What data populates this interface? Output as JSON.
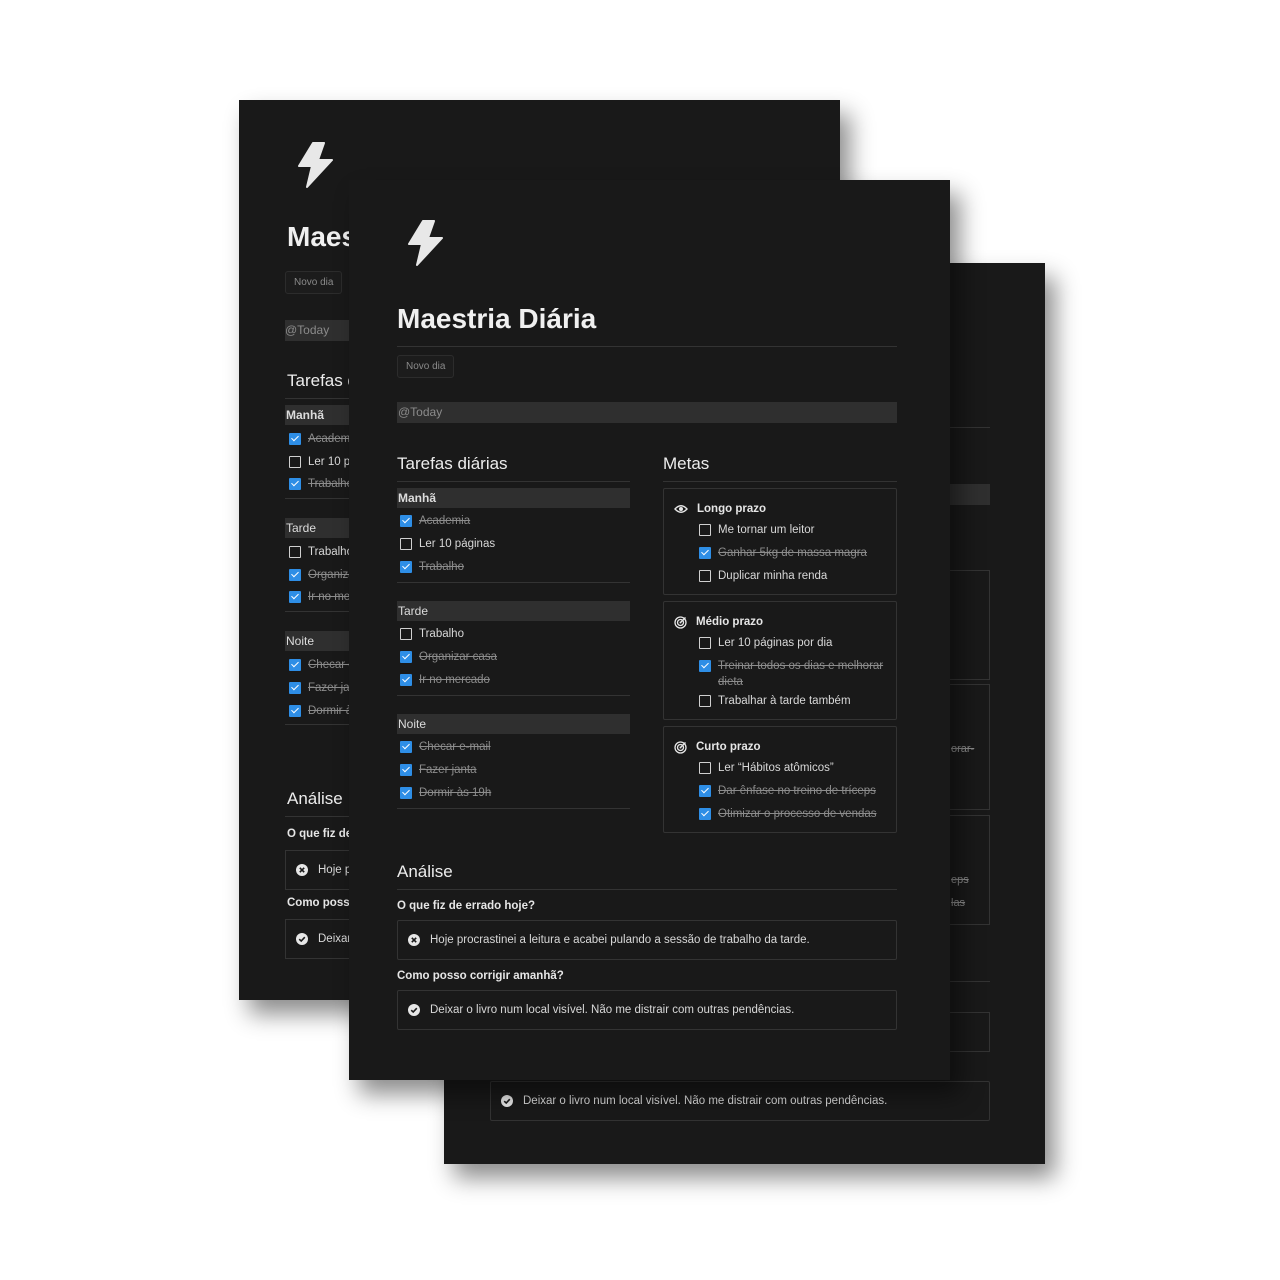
{
  "page": {
    "title": "Maestria Diária",
    "new_day_button": "Novo dia",
    "today_chip": "@Today"
  },
  "tasks": {
    "heading": "Tarefas diárias",
    "groups": [
      {
        "name": "Manhã",
        "items": [
          {
            "label": "Academia",
            "done": true
          },
          {
            "label": "Ler 10 páginas",
            "done": false
          },
          {
            "label": "Trabalho",
            "done": true
          }
        ]
      },
      {
        "name": "Tarde",
        "items": [
          {
            "label": "Trabalho",
            "done": false
          },
          {
            "label": "Organizar casa",
            "done": true
          },
          {
            "label": "Ir no mercado",
            "done": true
          }
        ]
      },
      {
        "name": "Noite",
        "items": [
          {
            "label": "Checar e-mail",
            "done": true
          },
          {
            "label": "Fazer janta",
            "done": true
          },
          {
            "label": "Dormir às 19h",
            "done": true
          }
        ]
      }
    ]
  },
  "goals": {
    "heading": "Metas",
    "sections": [
      {
        "name": "Longo prazo",
        "icon": "eye-icon",
        "items": [
          {
            "label": "Me tornar um leitor",
            "done": false
          },
          {
            "label": "Ganhar 5kg de massa magra",
            "done": true
          },
          {
            "label": "Duplicar minha renda",
            "done": false
          }
        ]
      },
      {
        "name": "Médio prazo",
        "icon": "target-icon",
        "items": [
          {
            "label": "Ler 10 páginas por dia",
            "done": false
          },
          {
            "label": "Treinar todos os dias e melhorar dieta",
            "done": true
          },
          {
            "label": "Trabalhar à tarde também",
            "done": false
          }
        ]
      },
      {
        "name": "Curto prazo",
        "icon": "target-icon",
        "items": [
          {
            "label": "Ler “Hábitos atômicos”",
            "done": false
          },
          {
            "label": "Dar ênfase no treino de tríceps",
            "done": true
          },
          {
            "label": "Otimizar o processo de vendas",
            "done": true
          }
        ]
      }
    ]
  },
  "analysis": {
    "heading": "Análise",
    "q1": "O que fiz de errado hoje?",
    "a1": "Hoje procrastinei a leitura e acabei pulando a sessão de trabalho da tarde.",
    "q2": "Como posso corrigir amanhã?",
    "a2": "Deixar o livro num local visível. Não me distrair com outras pendências."
  },
  "back_page": {
    "title_partial": "Maes",
    "tasks_partial": "Tarefas d",
    "group1": "Manhã",
    "items1": [
      "Academi",
      "Ler 10 pá",
      "Trabalho"
    ],
    "group2": "Tarde",
    "items2": [
      "Trabalho",
      "Organiza",
      "Ir no me"
    ],
    "group3": "Noite",
    "items3": [
      "Checar e",
      "Fazer jan",
      "Dormir à"
    ],
    "analysis": "Análise",
    "q1_partial": "O que fiz de",
    "a1_partial": "Hoje p",
    "q2_partial": "Como posso",
    "a2_partial": "Deixar"
  },
  "right_page": {
    "frag1": "orar-",
    "frag2": "eps",
    "frag3": "las",
    "answer": "Deixar o livro num local visível. Não me distrair com outras pendências."
  },
  "colors": {
    "card_bg": "#191919",
    "checkbox_checked": "#2e8ee6",
    "rule": "#333333"
  }
}
